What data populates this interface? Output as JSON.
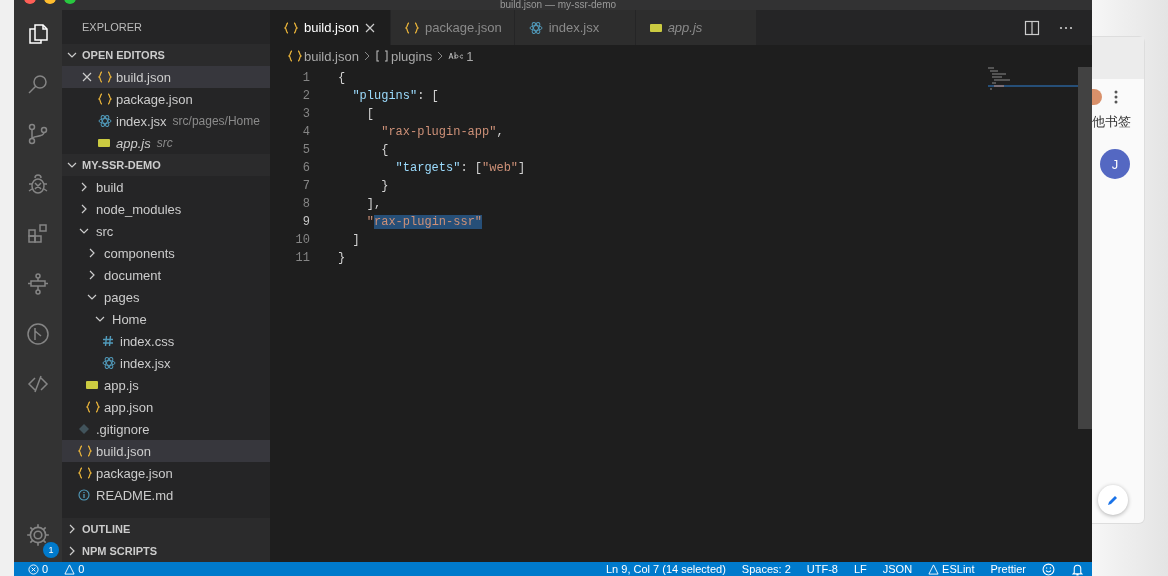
{
  "window": {
    "title": "build.json — my-ssr-demo"
  },
  "activity_bar": {
    "items": [
      {
        "kind": "files",
        "selected": true
      },
      {
        "kind": "search",
        "selected": false
      },
      {
        "kind": "source-control",
        "selected": false
      },
      {
        "kind": "debug",
        "selected": false
      },
      {
        "kind": "extensions",
        "selected": false
      },
      {
        "kind": "diagram",
        "selected": false
      },
      {
        "kind": "git",
        "selected": false
      },
      {
        "kind": "remote",
        "selected": false
      }
    ],
    "settings_badge": "1"
  },
  "sidebar": {
    "title": "EXPLORER",
    "open_editors": {
      "title": "OPEN EDITORS",
      "expanded": true,
      "items": [
        {
          "name": "build.json",
          "kind": "json",
          "active": true,
          "preview": false
        },
        {
          "name": "package.json",
          "kind": "json",
          "active": false,
          "preview": false
        },
        {
          "name": "index.jsx",
          "kind": "jsx",
          "description": "src/pages/Home",
          "active": false,
          "preview": false
        },
        {
          "name": "app.js",
          "kind": "js",
          "description": "src",
          "active": false,
          "preview": true
        }
      ]
    },
    "project": {
      "title": "MY-SSR-DEMO",
      "expanded": true,
      "items": [
        {
          "name": "build",
          "kind": "folder",
          "expanded": false,
          "selected": false
        },
        {
          "name": "node_modules",
          "kind": "folder",
          "expanded": false,
          "selected": false
        },
        {
          "name": "src",
          "kind": "folder",
          "expanded": true,
          "selected": false,
          "children": [
            {
              "name": "components",
              "kind": "folder",
              "expanded": false,
              "selected": false
            },
            {
              "name": "document",
              "kind": "folder",
              "expanded": false,
              "selected": false
            },
            {
              "name": "pages",
              "kind": "folder",
              "expanded": true,
              "selected": false,
              "children": [
                {
                  "name": "Home",
                  "kind": "folder",
                  "expanded": true,
                  "selected": false,
                  "children": [
                    {
                      "name": "index.css",
                      "kind": "css",
                      "selected": false
                    },
                    {
                      "name": "index.jsx",
                      "kind": "jsx",
                      "selected": false
                    }
                  ]
                }
              ]
            },
            {
              "name": "app.js",
              "kind": "js",
              "selected": false
            },
            {
              "name": "app.json",
              "kind": "json",
              "selected": false
            }
          ]
        },
        {
          "name": ".gitignore",
          "kind": "git",
          "selected": false
        },
        {
          "name": "build.json",
          "kind": "json",
          "selected": true
        },
        {
          "name": "package.json",
          "kind": "json",
          "selected": false
        },
        {
          "name": "README.md",
          "kind": "md",
          "selected": false
        }
      ]
    },
    "sections": [
      {
        "title": "OUTLINE",
        "expanded": false
      },
      {
        "title": "NPM SCRIPTS",
        "expanded": false
      }
    ]
  },
  "editor": {
    "tabs": [
      {
        "label": "build.json",
        "kind": "json",
        "selected": true,
        "preview": false
      },
      {
        "label": "package.json",
        "kind": "json",
        "selected": false,
        "preview": false
      },
      {
        "label": "index.jsx",
        "kind": "jsx",
        "selected": false,
        "preview": false
      },
      {
        "label": "app.js",
        "kind": "js",
        "selected": false,
        "preview": true
      }
    ],
    "breadcrumbs": [
      {
        "kind": "json",
        "text": "build.json"
      },
      {
        "kind": "array",
        "text": "plugins"
      },
      {
        "kind": "string",
        "text": "1"
      }
    ],
    "lines": [
      {
        "number": "1",
        "current": false,
        "tokens": [
          {
            "kind": "punct",
            "text": "{",
            "selected": false
          }
        ]
      },
      {
        "number": "2",
        "current": false,
        "tokens": [
          {
            "kind": "key",
            "text": "  \"plugins\"",
            "selected": false
          },
          {
            "kind": "punct",
            "text": ": [",
            "selected": false
          }
        ]
      },
      {
        "number": "3",
        "current": false,
        "tokens": [
          {
            "kind": "punct",
            "text": "    [",
            "selected": false
          }
        ]
      },
      {
        "number": "4",
        "current": false,
        "tokens": [
          {
            "kind": "string",
            "text": "      \"rax-plugin-app\"",
            "selected": false
          },
          {
            "kind": "punct",
            "text": ",",
            "selected": false
          }
        ]
      },
      {
        "number": "5",
        "current": false,
        "tokens": [
          {
            "kind": "punct",
            "text": "      {",
            "selected": false
          }
        ]
      },
      {
        "number": "6",
        "current": false,
        "tokens": [
          {
            "kind": "key",
            "text": "        \"targets\"",
            "selected": false
          },
          {
            "kind": "punct",
            "text": ": [",
            "selected": false
          },
          {
            "kind": "string",
            "text": "\"web\"",
            "selected": false
          },
          {
            "kind": "punct",
            "text": "]",
            "selected": false
          }
        ]
      },
      {
        "number": "7",
        "current": false,
        "tokens": [
          {
            "kind": "punct",
            "text": "      }",
            "selected": false
          }
        ]
      },
      {
        "number": "8",
        "current": false,
        "tokens": [
          {
            "kind": "punct",
            "text": "    ],",
            "selected": false
          }
        ]
      },
      {
        "number": "9",
        "current": true,
        "tokens": [
          {
            "kind": "string",
            "text": "    \"",
            "selected": false
          },
          {
            "kind": "string",
            "text": "rax-plugin-ssr\"",
            "selected": true
          }
        ]
      },
      {
        "number": "10",
        "current": false,
        "tokens": [
          {
            "kind": "punct",
            "text": "  ]",
            "selected": false
          }
        ]
      },
      {
        "number": "11",
        "current": false,
        "tokens": [
          {
            "kind": "punct",
            "text": "}",
            "selected": false
          }
        ]
      }
    ]
  },
  "status_bar": {
    "left": [
      {
        "kind": "errors",
        "text": "0"
      },
      {
        "kind": "warnings",
        "text": "0"
      }
    ],
    "right": [
      {
        "kind": "text",
        "text": "Ln 9, Col 7 (14 selected)"
      },
      {
        "kind": "text",
        "text": "Spaces: 2"
      },
      {
        "kind": "text",
        "text": "UTF-8"
      },
      {
        "kind": "text",
        "text": "LF"
      },
      {
        "kind": "text",
        "text": "JSON"
      },
      {
        "kind": "eslint",
        "text": "ESLint"
      },
      {
        "kind": "text",
        "text": "Prettier"
      },
      {
        "kind": "feedback"
      },
      {
        "kind": "bell"
      }
    ]
  },
  "browser": {
    "bookmark_label": "他书签",
    "avatar_letter": "J"
  }
}
